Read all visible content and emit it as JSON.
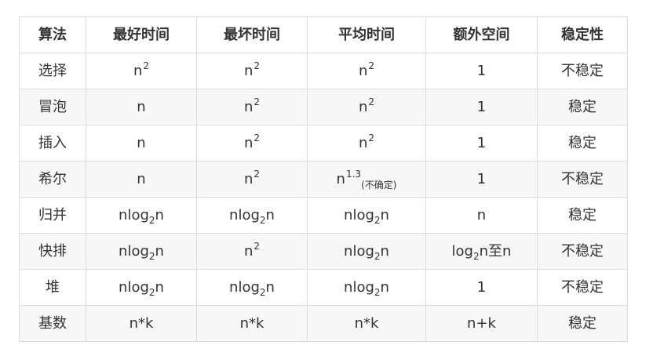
{
  "headers": [
    "算法",
    "最好时间",
    "最坏时间",
    "平均时间",
    "额外空间",
    "稳定性"
  ],
  "rows": [
    [
      {
        "text": "选择"
      },
      {
        "base": "n",
        "sup": "2"
      },
      {
        "base": "n",
        "sup": "2"
      },
      {
        "base": "n",
        "sup": "2"
      },
      {
        "text": "1"
      },
      {
        "text": "不稳定"
      }
    ],
    [
      {
        "text": "冒泡"
      },
      {
        "text": "n"
      },
      {
        "base": "n",
        "sup": "2"
      },
      {
        "base": "n",
        "sup": "2"
      },
      {
        "text": "1"
      },
      {
        "text": "稳定"
      }
    ],
    [
      {
        "text": "插入"
      },
      {
        "text": "n"
      },
      {
        "base": "n",
        "sup": "2"
      },
      {
        "base": "n",
        "sup": "2"
      },
      {
        "text": "1"
      },
      {
        "text": "稳定"
      }
    ],
    [
      {
        "text": "希尔"
      },
      {
        "text": "n"
      },
      {
        "base": "n",
        "sup": "2"
      },
      {
        "base": "n",
        "sup": "1.3",
        "note": "(不确定)"
      },
      {
        "text": "1"
      },
      {
        "text": "不稳定"
      }
    ],
    [
      {
        "text": "归并"
      },
      {
        "pre": "nlog",
        "sub": "2",
        "post": "n"
      },
      {
        "pre": "nlog",
        "sub": "2",
        "post": "n"
      },
      {
        "pre": "nlog",
        "sub": "2",
        "post": "n"
      },
      {
        "text": "n"
      },
      {
        "text": "稳定"
      }
    ],
    [
      {
        "text": "快排"
      },
      {
        "pre": "nlog",
        "sub": "2",
        "post": "n"
      },
      {
        "base": "n",
        "sup": "2"
      },
      {
        "pre": "nlog",
        "sub": "2",
        "post": "n"
      },
      {
        "pre": "log",
        "sub": "2",
        "post": "n至n"
      },
      {
        "text": "不稳定"
      }
    ],
    [
      {
        "text": "堆"
      },
      {
        "pre": "nlog",
        "sub": "2",
        "post": "n"
      },
      {
        "pre": "nlog",
        "sub": "2",
        "post": "n"
      },
      {
        "pre": "nlog",
        "sub": "2",
        "post": "n"
      },
      {
        "text": "1"
      },
      {
        "text": "不稳定"
      }
    ],
    [
      {
        "text": "基数"
      },
      {
        "text": "n*k"
      },
      {
        "text": "n*k"
      },
      {
        "text": "n*k"
      },
      {
        "text": "n+k"
      },
      {
        "text": "稳定"
      }
    ]
  ]
}
